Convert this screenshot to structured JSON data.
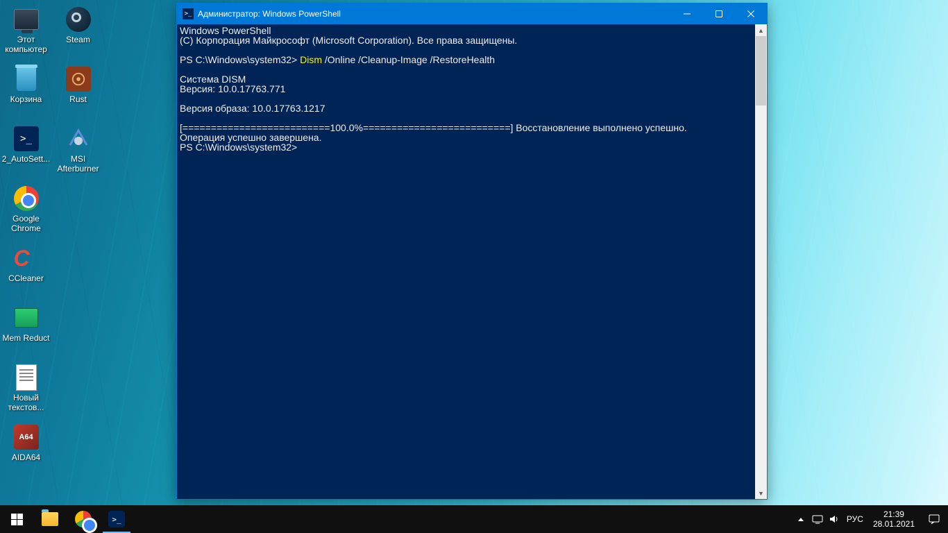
{
  "desktop": {
    "icons_col1": [
      {
        "name": "this-pc",
        "label": "Этот\nкомпьютер"
      },
      {
        "name": "recycle-bin",
        "label": "Корзина"
      },
      {
        "name": "autosettings",
        "label": "2_AutoSett..."
      },
      {
        "name": "chrome",
        "label": "Google\nChrome"
      },
      {
        "name": "ccleaner",
        "label": "CCleaner"
      },
      {
        "name": "mem-reduct",
        "label": "Mem Reduct"
      },
      {
        "name": "notepad-doc",
        "label": "Новый\nтекстов..."
      },
      {
        "name": "aida64",
        "label": "AIDA64"
      }
    ],
    "icons_col2": [
      {
        "name": "steam",
        "label": "Steam"
      },
      {
        "name": "rust",
        "label": "Rust"
      },
      {
        "name": "msi-afterburner",
        "label": "MSI\nAfterburner"
      }
    ]
  },
  "powershell": {
    "title": "Администратор: Windows PowerShell",
    "lines": {
      "l1": "Windows PowerShell",
      "l2": "(C) Корпорация Майкрософт (Microsoft Corporation). Все права защищены.",
      "promptA": "PS C:\\Windows\\system32> ",
      "cmd1": "Dism",
      "cmd2": " /Online /Cleanup-Image /RestoreHealth",
      "l5": "Cистема DISM",
      "l6": "Версия: 10.0.17763.771",
      "l7": "Версия образа: 10.0.17763.1217",
      "l8": "[==========================100.0%==========================] Восстановление выполнено успешно.",
      "l9": "Операция успешно завершена.",
      "promptB": "PS C:\\Windows\\system32> "
    }
  },
  "taskbar": {
    "lang": "РУС",
    "time": "21:39",
    "date": "28.01.2021"
  },
  "glyphs": {
    "ps": ">_",
    "aida": "A64"
  }
}
